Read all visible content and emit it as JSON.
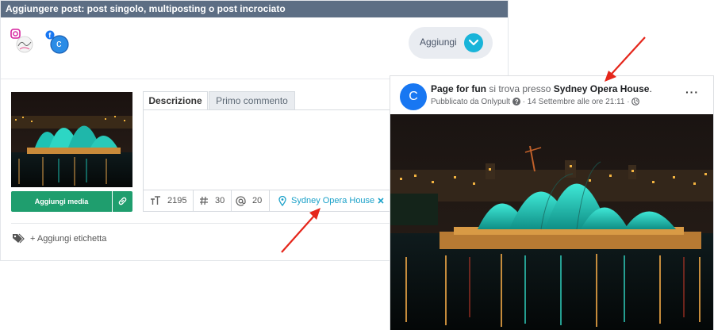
{
  "editor": {
    "title": "Aggiungere post: post singolo, multiposting o post incrociato",
    "add_button": "Aggiungi",
    "account_letter": "c",
    "media_button": "Aggiungi media",
    "tabs": [
      "Descrizione",
      "Primo commento"
    ],
    "counters": {
      "chars": "2195",
      "hashtags": "30",
      "mentions": "20"
    },
    "location": "Sydney Opera House",
    "tag_label": "+ Aggiungi etichetta"
  },
  "facebook_post": {
    "avatar_letter": "C",
    "page_name": "Page for fun",
    "location_text": " si trova presso ",
    "location": "Sydney Opera House",
    "location_suffix": ".",
    "published_by": "Pubblicato da Onlypult",
    "date": "· 14 Settembre alle ore 21:11 ·",
    "menu": "···"
  },
  "colors": {
    "header": "#5d6e84",
    "accent": "#19b4d9",
    "green": "#1f9e6e",
    "facebook": "#1877f2",
    "arrow": "#e5261b"
  },
  "icons": [
    "instagram-icon",
    "facebook-icon",
    "chevron-down-icon",
    "link-icon",
    "text-size-icon",
    "hashtag-icon",
    "at-icon",
    "location-pin-icon",
    "close-icon",
    "tag-icon",
    "question-icon",
    "globe-icon"
  ]
}
